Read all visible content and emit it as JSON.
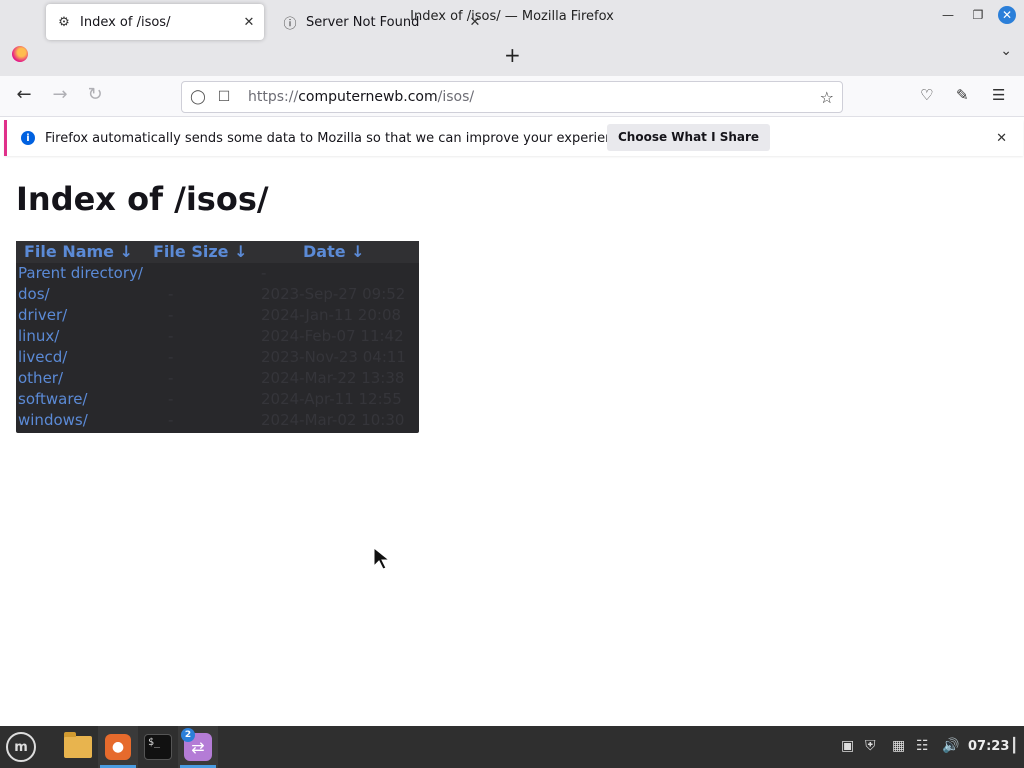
{
  "window": {
    "title": "Index of /isos/ — Mozilla Firefox",
    "controls": [
      "minimize-icon",
      "maximize-icon",
      "close-icon"
    ]
  },
  "tabs": [
    {
      "label": "Index of /isos/",
      "icon": "directory-icon",
      "active": true
    },
    {
      "label": "Server Not Found",
      "icon": "info-icon",
      "active": false
    }
  ],
  "nav": {
    "url_scheme": "https://",
    "url_host": "computernewb.com",
    "url_path": "/isos/"
  },
  "notification": {
    "message": "Firefox automatically sends some data to Mozilla so that we can improve your experience.",
    "button_label": "Choose What I Share"
  },
  "page": {
    "heading": "Index of /isos/",
    "columns": {
      "name": "File Name  ↓",
      "size": "File Size  ↓",
      "date": "Date  ↓"
    },
    "rows": [
      {
        "name": "Parent directory/",
        "size": "",
        "date": "-"
      },
      {
        "name": "dos/",
        "size": "-",
        "date": "2023-Sep-27 09:52"
      },
      {
        "name": "driver/",
        "size": "-",
        "date": "2024-Jan-11 20:08"
      },
      {
        "name": "linux/",
        "size": "-",
        "date": "2024-Feb-07 11:42"
      },
      {
        "name": "livecd/",
        "size": "-",
        "date": "2023-Nov-23 04:11"
      },
      {
        "name": "other/",
        "size": "-",
        "date": "2024-Mar-22 13:38"
      },
      {
        "name": "software/",
        "size": "-",
        "date": "2024-Apr-11 12:55"
      },
      {
        "name": "windows/",
        "size": "-",
        "date": "2024-Mar-02 10:30"
      }
    ]
  },
  "taskbar": {
    "badge_count": "2",
    "clock": "07:23",
    "accent": "#4a9ce2"
  }
}
